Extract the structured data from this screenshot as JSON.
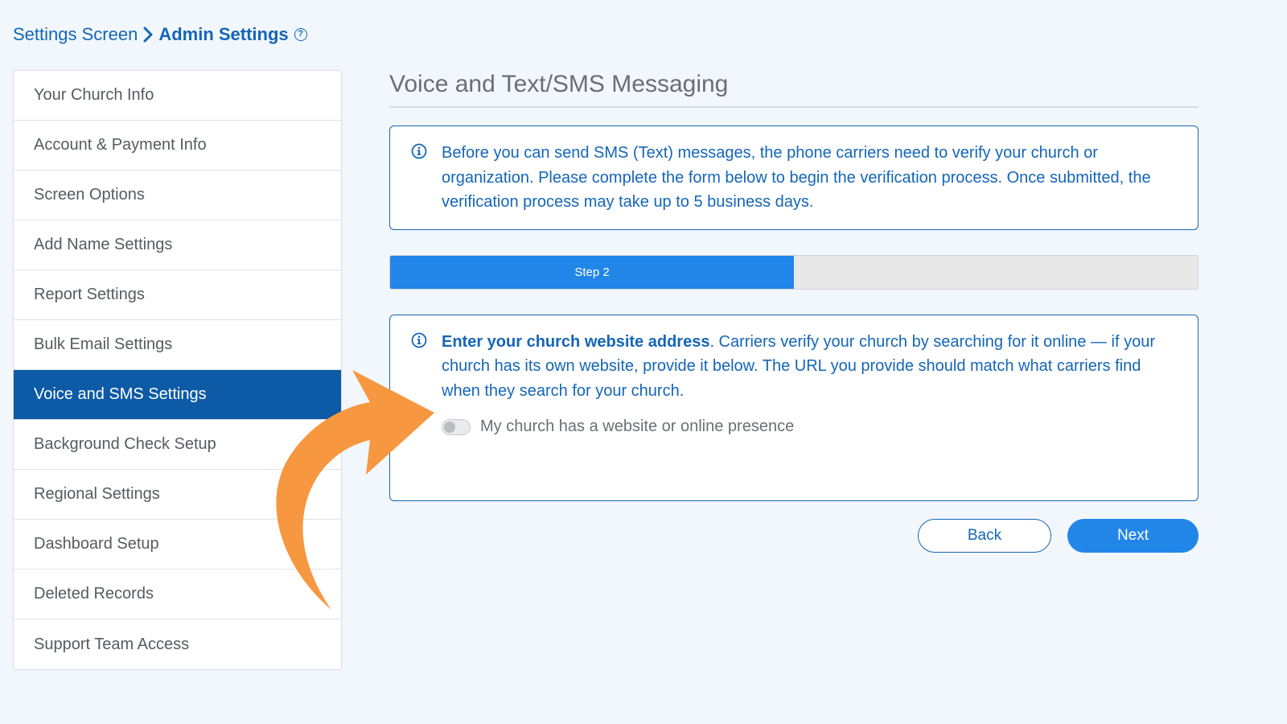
{
  "breadcrumb": {
    "parent": "Settings Screen",
    "current": "Admin Settings",
    "help_icon": "question-circle-icon"
  },
  "sidebar": {
    "items": [
      {
        "label": "Your Church Info",
        "active": false
      },
      {
        "label": "Account & Payment Info",
        "active": false
      },
      {
        "label": "Screen Options",
        "active": false
      },
      {
        "label": "Add Name Settings",
        "active": false
      },
      {
        "label": "Report Settings",
        "active": false
      },
      {
        "label": "Bulk Email Settings",
        "active": false
      },
      {
        "label": "Voice and SMS Settings",
        "active": true
      },
      {
        "label": "Background Check Setup",
        "active": false
      },
      {
        "label": "Regional Settings",
        "active": false
      },
      {
        "label": "Dashboard Setup",
        "active": false
      },
      {
        "label": "Deleted Records",
        "active": false
      },
      {
        "label": "Support Team Access",
        "active": false
      }
    ]
  },
  "main": {
    "title": "Voice and Text/SMS Messaging",
    "intro_notice": "Before you can send SMS (Text) messages, the phone carriers need to verify your church or organization. Please complete the form below to begin the verification process. Once submitted, the verification process may take up to 5 business days.",
    "progress": {
      "label": "Step 2",
      "fraction": 0.5
    },
    "step": {
      "heading": "Enter your church website address",
      "body": ". Carriers verify your church by searching for it online — if your church has its own website, provide it below. The URL you provide should match what carriers find when they search for your church.",
      "toggle_label": "My church has a website or online presence",
      "toggle_on": false
    },
    "buttons": {
      "back": "Back",
      "next": "Next"
    }
  },
  "colors": {
    "brand_blue": "#1466b8",
    "active_nav": "#0d5aa7",
    "primary_button": "#2286e8",
    "annotation_arrow": "#f7973f",
    "background": "#f1f7fc"
  }
}
